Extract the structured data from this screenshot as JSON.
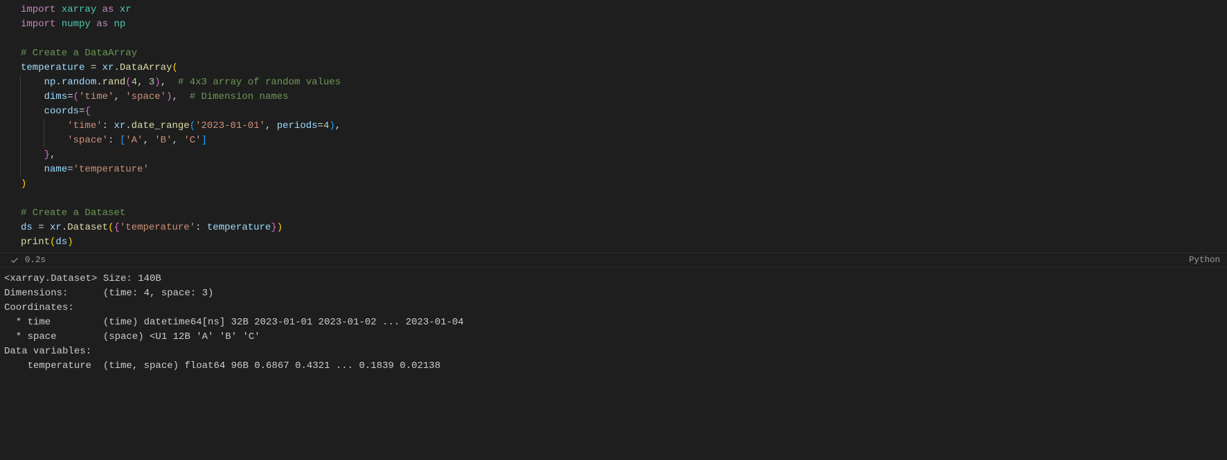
{
  "code": {
    "tokens": {
      "import": "import",
      "as": "as",
      "xarray": "xarray",
      "xr": "xr",
      "numpy": "numpy",
      "np": "np",
      "comment_create_da": "# Create a DataArray",
      "temperature": "temperature",
      "eq": " = ",
      "dot": ".",
      "DataArray": "DataArray",
      "random": "random",
      "rand": "rand",
      "four": "4",
      "three": "3",
      "comment_4x3": "# 4x3 array of random values",
      "dims": "dims",
      "dims_time": "'time'",
      "dims_space": "'space'",
      "comment_dimnames": "# Dimension names",
      "coords": "coords",
      "k_time": "'time'",
      "date_range": "date_range",
      "date_start": "'2023-01-01'",
      "periods": "periods",
      "periods_v": "4",
      "k_space": "'space'",
      "sp_a": "'A'",
      "sp_b": "'B'",
      "sp_c": "'C'",
      "name": "name",
      "name_v": "'temperature'",
      "comment_create_ds": "# Create a Dataset",
      "ds": "ds",
      "Dataset": "Dataset",
      "ds_key": "'temperature'",
      "print": "print",
      "print_arg": "ds"
    }
  },
  "status": {
    "icon": "check-icon",
    "duration": "0.2s",
    "language": "Python"
  },
  "output": {
    "lines": [
      "<xarray.Dataset> Size: 140B",
      "Dimensions:      (time: 4, space: 3)",
      "Coordinates:",
      "  * time         (time) datetime64[ns] 32B 2023-01-01 2023-01-02 ... 2023-01-04",
      "  * space        (space) <U1 12B 'A' 'B' 'C'",
      "Data variables:",
      "    temperature  (time, space) float64 96B 0.6867 0.4321 ... 0.1839 0.02138"
    ]
  }
}
